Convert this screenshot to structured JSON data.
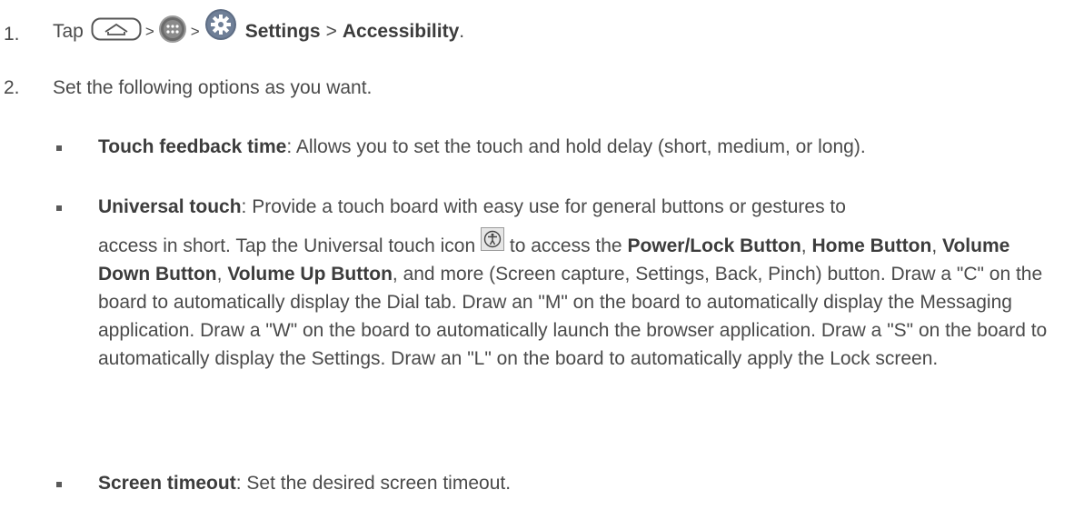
{
  "steps": [
    {
      "num": "1.",
      "tap": "Tap",
      "sep1": ">",
      "sep2": ">",
      "settings": "Settings",
      "sep3": ">",
      "accessibility": "Accessibility",
      "end": ".",
      "icons": [
        "home-key-icon",
        "apps-icon",
        "settings-gear-icon"
      ]
    },
    {
      "num": "2.",
      "text": "Set the following options as you want."
    }
  ],
  "options": [
    {
      "title": "Touch feedback time",
      "desc": ": Allows you to set the touch and hold delay (short, medium, or long)."
    },
    {
      "title": "Universal touch",
      "line1": ": Provide a touch board with easy use for general buttons or gestures to",
      "line2a": "access in short. Tap the Universal touch icon",
      "icon": "accessibility-icon",
      "line2b": "to access the",
      "b1": "Power/Lock Button",
      "c1": ",",
      "b2": "Home",
      "b3": "Button",
      "c2": ",",
      "b4": "Volume Down Button",
      "c3": ",",
      "b5": "Volume Up Button",
      "rest": ", and more (Screen capture, Settings, Back, Pinch) button. Draw a \"C\" on the board to automatically display the Dial tab. Draw an \"M\" on the board to automatically display the Messaging application. Draw a \"W\" on the board to automatically launch the browser application. Draw a \"S\" on the board to automatically display the Settings. Draw an \"L\" on the board to automatically apply the Lock screen."
    },
    {
      "title": "Screen timeout",
      "desc": ": Set the desired screen timeout."
    }
  ]
}
